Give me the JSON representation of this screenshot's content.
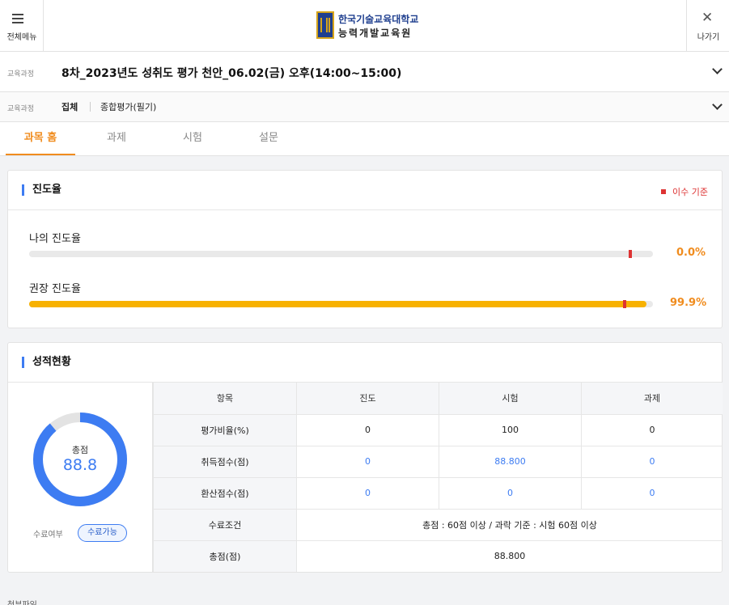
{
  "header": {
    "menu_label": "전체메뉴",
    "exit_label": "나가기",
    "logo_line1": "한국기술교육대학교",
    "logo_line2": "능력개발교육원"
  },
  "course": {
    "label1": "교육과정",
    "title": "8차_2023년도 성취도 평가 천안_06.02(금) 오후(14:00~15:00)",
    "label2": "교육과정",
    "type": "집체",
    "subject": "종합평가(필기)"
  },
  "tabs": [
    {
      "label": "과목 홈",
      "active": true
    },
    {
      "label": "과제",
      "active": false
    },
    {
      "label": "시험",
      "active": false
    },
    {
      "label": "설문",
      "active": false
    }
  ],
  "progress": {
    "title": "진도율",
    "legend": "이수 기준",
    "my_label": "나의 진도율",
    "my_value": "0.0%",
    "my_fraction": 0.0,
    "rec_label": "권장 진도율",
    "rec_value": "99.9%",
    "rec_fraction": 0.999,
    "colors": {
      "fill": "#f7b100",
      "marker": "#dd3333",
      "value": "#f08c1e"
    }
  },
  "grades": {
    "title": "성적현황",
    "total_caption": "총점",
    "total_value": "88.8",
    "total_fraction": 0.888,
    "completion_label": "수료여부",
    "completion_status": "수료가능",
    "table": {
      "headers": [
        "항목",
        "진도",
        "시험",
        "과제"
      ],
      "rows": [
        {
          "label": "평가비율(%)",
          "cells": [
            "0",
            "100",
            "0"
          ]
        },
        {
          "label": "취득점수(점)",
          "cells": [
            "0",
            "88.800",
            "0"
          ]
        },
        {
          "label": "환산점수(점)",
          "cells": [
            "0",
            "0",
            "0"
          ]
        }
      ],
      "condition_label": "수료조건",
      "condition_text": "총점 : 60점 이상 / 과락 기준 : 시험 60점 이상",
      "total_label": "총점(점)",
      "total_text": "88.800"
    },
    "colors": {
      "accent": "#3d7cf2",
      "track": "#e3e3e3"
    }
  },
  "attachments_label": "첨부파일"
}
